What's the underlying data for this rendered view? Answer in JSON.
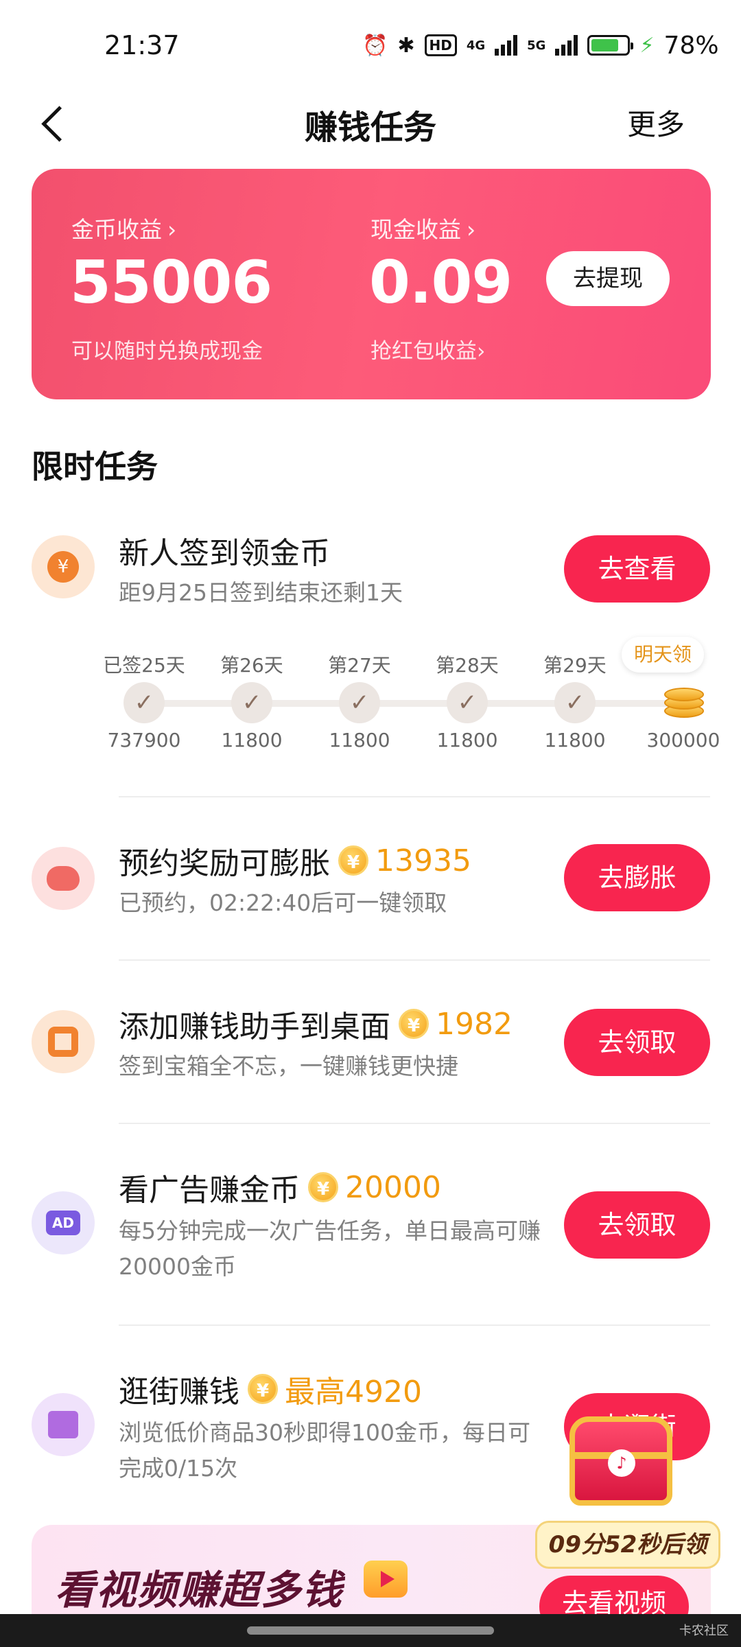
{
  "status_bar": {
    "time": "21:37",
    "network_4g": "4G",
    "network_5g": "5G",
    "hd": "HD",
    "battery_pct": "78%",
    "battery_level": 0.78
  },
  "nav": {
    "title": "赚钱任务",
    "more": "更多"
  },
  "earnings": {
    "coin_label": "金币收益",
    "coin_value": "55006",
    "coin_sub": "可以随时兑换成现金",
    "cash_label": "现金收益",
    "cash_value": "0.09",
    "cash_sub": "抢红包收益",
    "withdraw_label": "去提现",
    "chevron": "›"
  },
  "section_title": "限时任务",
  "tasks": [
    {
      "title": "新人签到领金币",
      "desc": "距9月25日签到结束还剩1天",
      "button": "去查看",
      "icon": "yen-icon"
    },
    {
      "title": "预约奖励可膨胀",
      "reward": "13935",
      "desc": "已预约，02:22:40后可一键领取",
      "button": "去膨胀",
      "icon": "piggy-bank-icon"
    },
    {
      "title": "添加赚钱助手到桌面",
      "reward": "1982",
      "desc": "签到宝箱全不忘，一键赚钱更快捷",
      "button": "去领取",
      "icon": "widget-icon"
    },
    {
      "title": "看广告赚金币",
      "reward": "20000",
      "desc": "每5分钟完成一次广告任务，单日最高可赚20000金币",
      "button": "去领取",
      "icon": "ad-icon",
      "icon_text": "AD"
    },
    {
      "title": "逛街赚钱",
      "reward": "最高4920",
      "desc": "浏览低价商品30秒即得100金币，每日可完成0/15次",
      "button": "去逛街",
      "icon": "shop-icon"
    }
  ],
  "coin_symbol": "¥",
  "checkin": {
    "days": [
      {
        "label": "已签25天",
        "amount": "737900"
      },
      {
        "label": "第26天",
        "amount": "11800"
      },
      {
        "label": "第27天",
        "amount": "11800"
      },
      {
        "label": "第28天",
        "amount": "11800"
      },
      {
        "label": "第29天",
        "amount": "11800"
      },
      {
        "label": "明天领",
        "amount": "300000"
      }
    ],
    "check": "✓"
  },
  "banner": {
    "title": "看视频赚超多钱",
    "button": "去看视频"
  },
  "treasure": {
    "countdown": "09分52秒后领"
  },
  "watermark": "卡农社区",
  "colors": {
    "accent": "#f8254f",
    "card_gradient": "#f2506d",
    "reward": "#f29b0f"
  }
}
